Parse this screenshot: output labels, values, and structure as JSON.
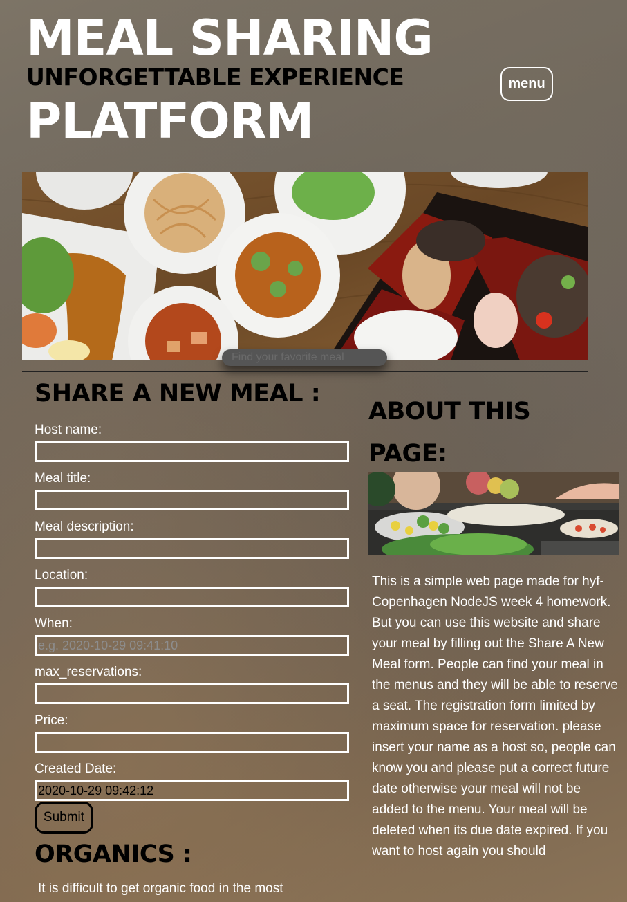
{
  "header": {
    "title_line1": "MEAL SHARING",
    "title_line2": "UNFORGETTABLE EXPERIENCE",
    "title_line3": "PLATFORM",
    "menu_label": "menu"
  },
  "search": {
    "placeholder": "Find your favorite meal"
  },
  "share_form": {
    "title": "SHARE A NEW MEAL :",
    "fields": [
      {
        "label": "Host name:",
        "value": "",
        "placeholder": ""
      },
      {
        "label": "Meal title:",
        "value": "",
        "placeholder": ""
      },
      {
        "label": "Meal description:",
        "value": "",
        "placeholder": ""
      },
      {
        "label": "Location:",
        "value": "",
        "placeholder": ""
      },
      {
        "label": "When:",
        "value": "",
        "placeholder": "e.g. 2020-10-29 09:41:10"
      },
      {
        "label": "max_reservations:",
        "value": "",
        "placeholder": ""
      },
      {
        "label": "Price:",
        "value": "",
        "placeholder": ""
      },
      {
        "label": "Created Date:",
        "value": "2020-10-29 09:42:12",
        "placeholder": ""
      }
    ],
    "submit_label": "Submit"
  },
  "organics": {
    "title": "ORGANICS :",
    "text": "It is difficult to get organic food in the most"
  },
  "about": {
    "title": "ABOUT THIS PAGE:",
    "text": "This is a simple web page made for hyf-Copenhagen NodeJS week 4 homework. But you can use this website and share your meal by filling out the Share A New Meal form. People can find your meal in the menus and they will be able to reserve a seat. The registration form limited by maximum space for reservation. please insert your name as a host so, people can know you and please put a correct future date otherwise your meal will not be added to the menu. Your meal will be deleted when its due date expired. If you want to host again you should"
  }
}
